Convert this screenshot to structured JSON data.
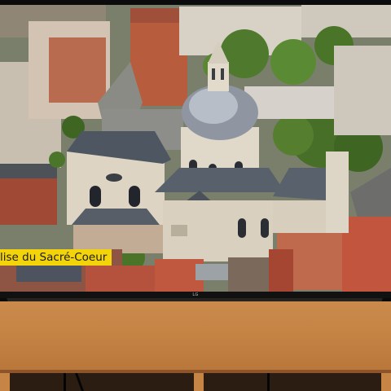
{
  "scene": {
    "caption": "lise du Sacré-Coeur",
    "tv_brand": "LG"
  }
}
